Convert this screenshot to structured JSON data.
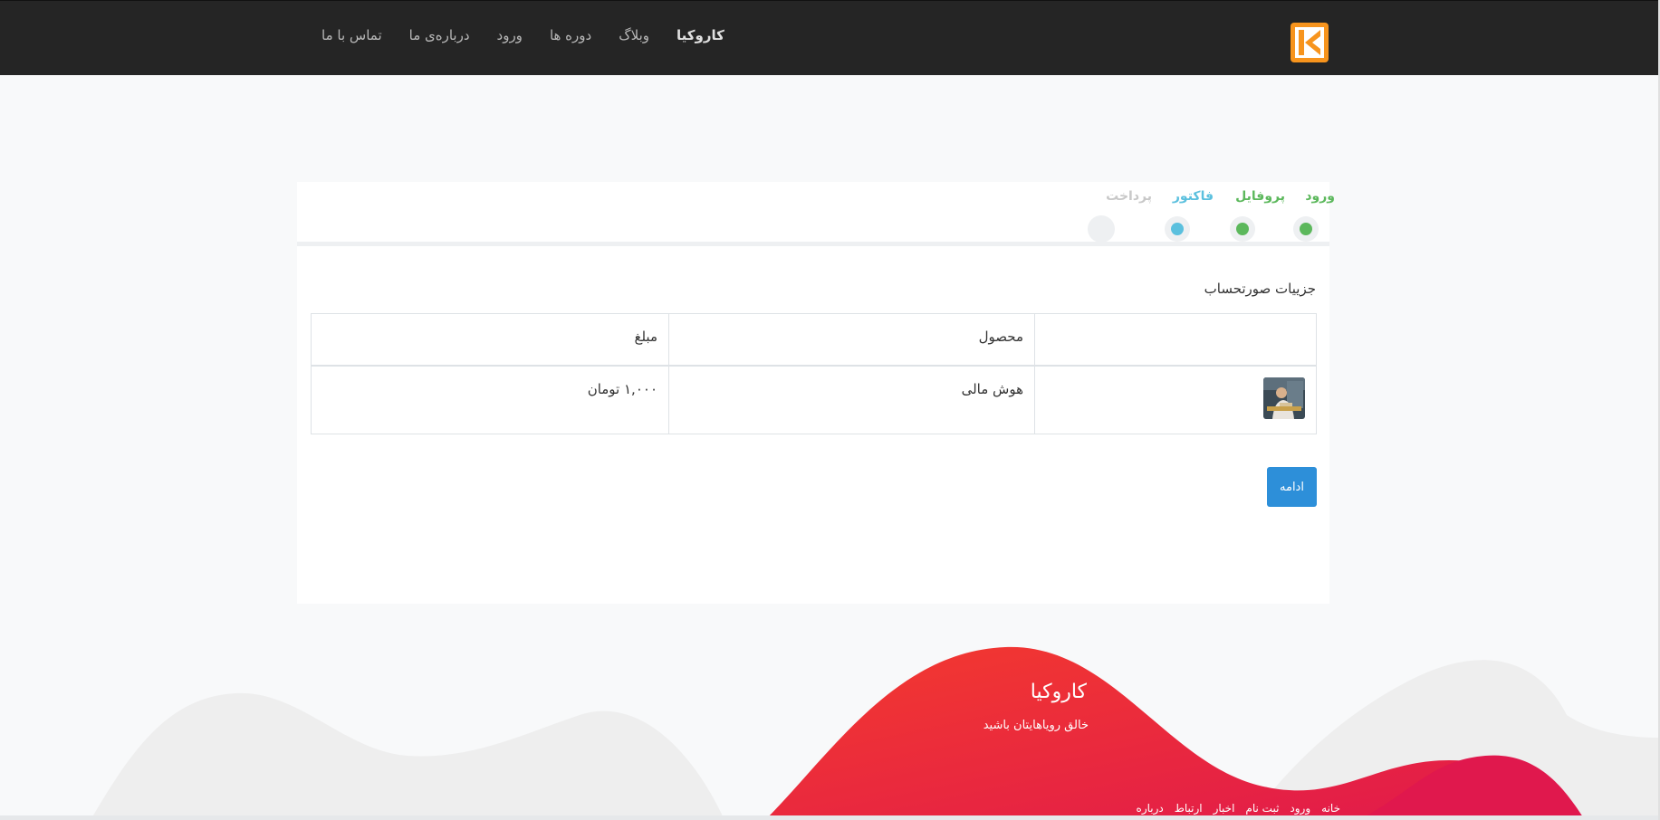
{
  "navbar": {
    "brand": "کاروکیا",
    "links": [
      "وبلاگ",
      "دوره ها",
      "ورود",
      "درباره‌ی ما",
      "تماس با ما"
    ],
    "logo_letter": "K"
  },
  "steps": [
    {
      "label": "ورود",
      "state": "done",
      "color": "#5cb85c"
    },
    {
      "label": "پروفایل",
      "state": "done",
      "color": "#5cb85c"
    },
    {
      "label": "فاکتور",
      "state": "active",
      "color": "#5bc0de"
    },
    {
      "label": "پرداخت",
      "state": "pending",
      "color": "#c8c8c8"
    }
  ],
  "invoice": {
    "title": "جزییات صورتحساب",
    "headers": [
      "",
      "محصول",
      "مبلغ"
    ],
    "rows": [
      {
        "product": "هوش مالی",
        "price": "۱,۰۰۰ تومان"
      }
    ],
    "continue_label": "ادامه"
  },
  "footer": {
    "title": "کاروکیا",
    "tagline": "خالق رویاهایتان باشید",
    "links": [
      "خانه",
      "ورود",
      "ثبت نام",
      "اخبار",
      "ارتباط",
      "درباره"
    ]
  },
  "colors": {
    "navbar": "#252525",
    "accent_green": "#5cb85c",
    "accent_blue": "#5bc0de",
    "button": "#2d8fd9",
    "footer_red": "#ee2a3a",
    "logo_orange": "#f7941d"
  }
}
